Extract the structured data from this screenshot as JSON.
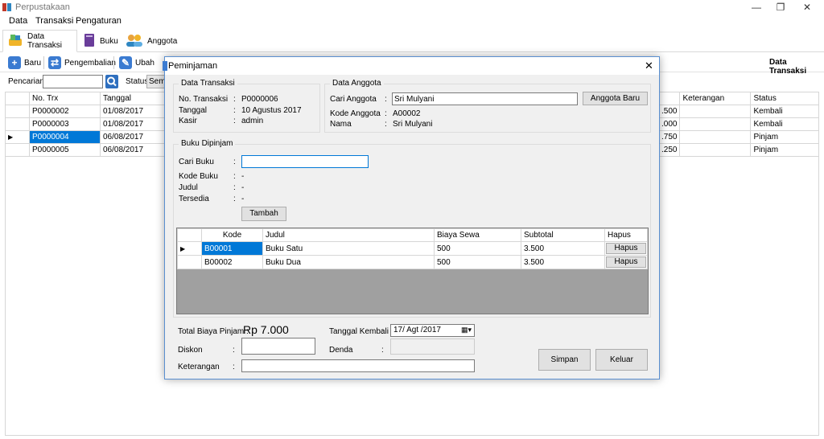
{
  "app": {
    "title": "Perpustakaan"
  },
  "window_controls": {
    "minimize": "—",
    "restore": "❐",
    "close": "✕"
  },
  "menu": [
    "Data",
    "Transaksi",
    "Pengaturan"
  ],
  "tabs": [
    {
      "label": "Data Transaksi",
      "icon": "books-icon"
    },
    {
      "label": "Buku",
      "icon": "book-icon"
    },
    {
      "label": "Anggota",
      "icon": "users-icon"
    }
  ],
  "toolbar": {
    "baru": "Baru",
    "pengembalian": "Pengembalian",
    "ubah": "Ubah",
    "right_title": "Data Transaksi",
    "pencarian_label": "Pencarian",
    "status_label": "Status",
    "status_value": "Sem"
  },
  "main_grid": {
    "columns": [
      "No. Trx",
      "Tanggal",
      "Keterangan",
      "Status"
    ],
    "rows": [
      {
        "no": "P0000002",
        "tanggal": "01/08/2017",
        "biaya": ".500",
        "ket": "",
        "status": "Kembali"
      },
      {
        "no": "P0000003",
        "tanggal": "01/08/2017",
        "biaya": ".000",
        "ket": "",
        "status": "Kembali"
      },
      {
        "no": "P0000004",
        "tanggal": "06/08/2017",
        "biaya": ".750",
        "ket": "",
        "status": "Pinjam"
      },
      {
        "no": "P0000005",
        "tanggal": "06/08/2017",
        "biaya": ".250",
        "ket": "",
        "status": "Pinjam"
      }
    ]
  },
  "dialog": {
    "title": "Peminjaman",
    "close": "✕",
    "transaksi": {
      "title": "Data Transaksi",
      "no_label": "No. Transaksi",
      "no_value": "P0000006",
      "tanggal_label": "Tanggal",
      "tanggal_value": "10 Agustus 2017",
      "kasir_label": "Kasir",
      "kasir_value": "admin"
    },
    "anggota": {
      "title": "Data Anggota",
      "cari_label": "Cari Anggota",
      "cari_value": "Sri Mulyani",
      "baru_button": "Anggota Baru",
      "kode_label": "Kode Anggota",
      "kode_value": "A00002",
      "nama_label": "Nama",
      "nama_value": "Sri Mulyani"
    },
    "buku": {
      "title": "Buku Dipinjam",
      "cari_label": "Cari Buku",
      "cari_value": "",
      "kode_label": "Kode Buku",
      "kode_value": "-",
      "judul_label": "Judul",
      "judul_value": "-",
      "tersedia_label": "Tersedia",
      "tersedia_value": "-",
      "tambah_button": "Tambah"
    },
    "grid": {
      "columns": [
        "Kode",
        "Judul",
        "Biaya Sewa",
        "Subtotal",
        "Hapus"
      ],
      "rows": [
        {
          "kode": "B00001",
          "judul": "Buku Satu",
          "biaya": "500",
          "subtotal": "3.500",
          "hapus": "Hapus"
        },
        {
          "kode": "B00002",
          "judul": "Buku Dua",
          "biaya": "500",
          "subtotal": "3.500",
          "hapus": "Hapus"
        }
      ]
    },
    "footer": {
      "total_label": "Total Biaya Pinjam :",
      "total_value": "Rp 7.000",
      "tgl_kembali_label": "Tanggal Kembali",
      "tgl_kembali_value": "17/ Agt /2017",
      "diskon_label": "Diskon",
      "denda_label": "Denda",
      "keterangan_label": "Keterangan",
      "simpan": "Simpan",
      "keluar": "Keluar"
    },
    "colon": ":"
  }
}
